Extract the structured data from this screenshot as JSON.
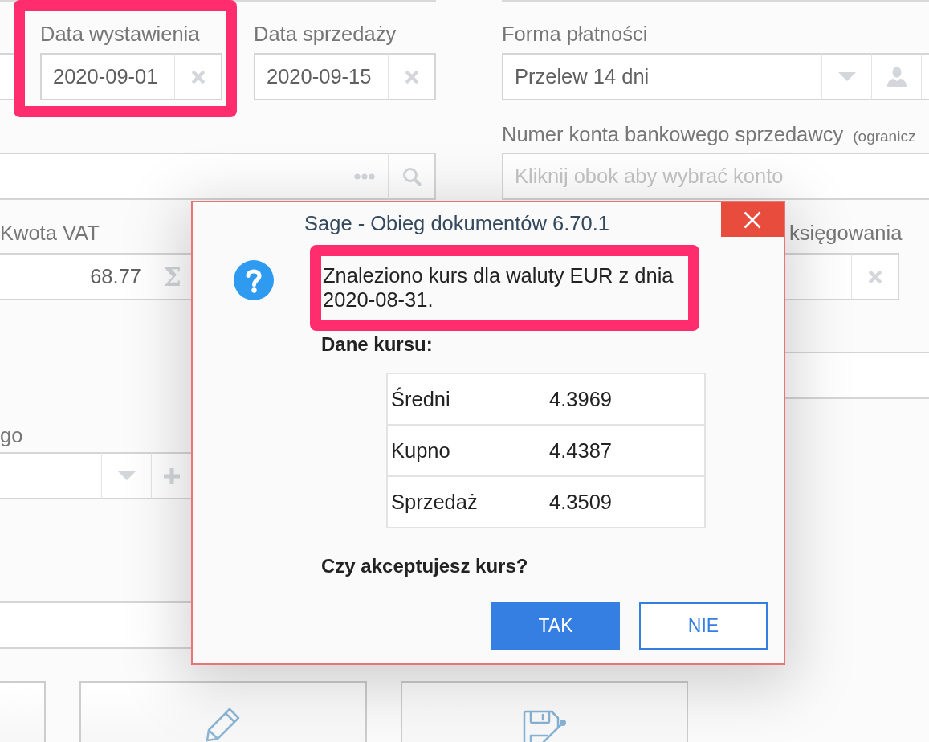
{
  "form": {
    "left": {
      "date_fields": [
        {
          "label": "Data wystawienia",
          "value": "2020-09-01",
          "highlighted": true
        },
        {
          "label": "Data sprzedaży",
          "value": "2020-09-15",
          "highlighted": false
        }
      ],
      "vat_amount": {
        "label": "Kwota VAT",
        "value": "68.77",
        "sum_symbol": "Σ"
      },
      "dropdown": {
        "label": "go"
      }
    },
    "right": {
      "payment_method": {
        "label": "Forma płatności",
        "value": "Przelew 14 dni"
      },
      "bank_account": {
        "label": "Numer konta bankowego sprzedawcy",
        "note": "(ogranicz",
        "placeholder": "Kliknij obok aby wybrać konto"
      },
      "posting_date": {
        "label": "księgowania"
      }
    }
  },
  "dialog": {
    "title": "Sage - Obieg dokumentów 6.70.1",
    "message": "Znaleziono kurs dla waluty EUR z dnia 2020-08-31.",
    "message_highlighted": true,
    "rates_title": "Dane kursu:",
    "rates": [
      {
        "name": "Średni",
        "value": "4.3969"
      },
      {
        "name": "Kupno",
        "value": "4.4387"
      },
      {
        "name": "Sprzedaż",
        "value": "4.3509"
      }
    ],
    "question": "Czy akceptujesz kurs?",
    "buttons": [
      {
        "label": "TAK",
        "kind": "primary"
      },
      {
        "label": "NIE",
        "kind": "secondary"
      }
    ]
  }
}
